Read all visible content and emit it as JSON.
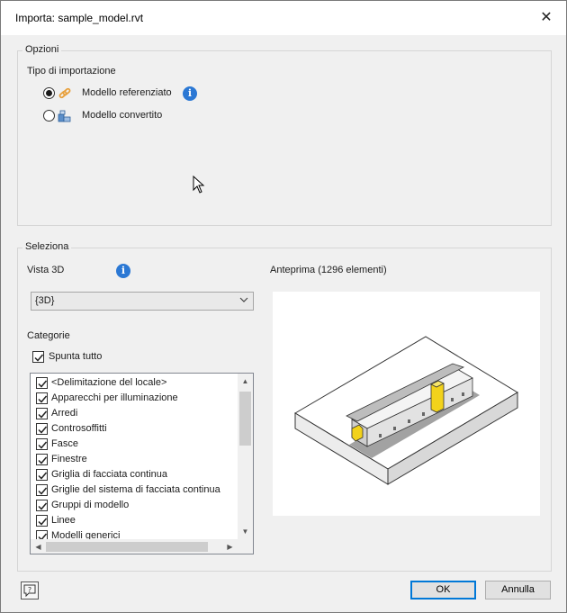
{
  "window": {
    "title": "Importa: sample_model.rvt"
  },
  "options": {
    "legend": "Opzioni",
    "import_type_label": "Tipo di importazione",
    "radio_referenced": "Modello referenziato",
    "radio_converted": "Modello convertito",
    "selected": "referenced"
  },
  "selection": {
    "legend": "Seleziona",
    "view3d_label": "Vista 3D",
    "view3d_value": "{3D}",
    "preview_label": "Anteprima (1296 elementi)",
    "categories_label": "Categorie",
    "check_all_label": "Spunta tutto",
    "check_all_checked": true,
    "categories": [
      {
        "label": "<Delimitazione del locale>",
        "checked": true
      },
      {
        "label": "Apparecchi per illuminazione",
        "checked": true
      },
      {
        "label": "Arredi",
        "checked": true
      },
      {
        "label": "Controsoffitti",
        "checked": true
      },
      {
        "label": "Fasce",
        "checked": true
      },
      {
        "label": "Finestre",
        "checked": true
      },
      {
        "label": "Griglia di facciata continua",
        "checked": true
      },
      {
        "label": "Griglie del sistema di facciata continua",
        "checked": true
      },
      {
        "label": "Gruppi di modello",
        "checked": true
      },
      {
        "label": "Linee",
        "checked": true
      },
      {
        "label": "Modelli generici",
        "checked": true
      }
    ]
  },
  "footer": {
    "ok_label": "OK",
    "cancel_label": "Annulla"
  },
  "colors": {
    "dialog_bg": "#f0f0f0",
    "info_icon": "#2b78d4",
    "ok_border": "#0078d7",
    "link_icon": "#e8a03c"
  }
}
